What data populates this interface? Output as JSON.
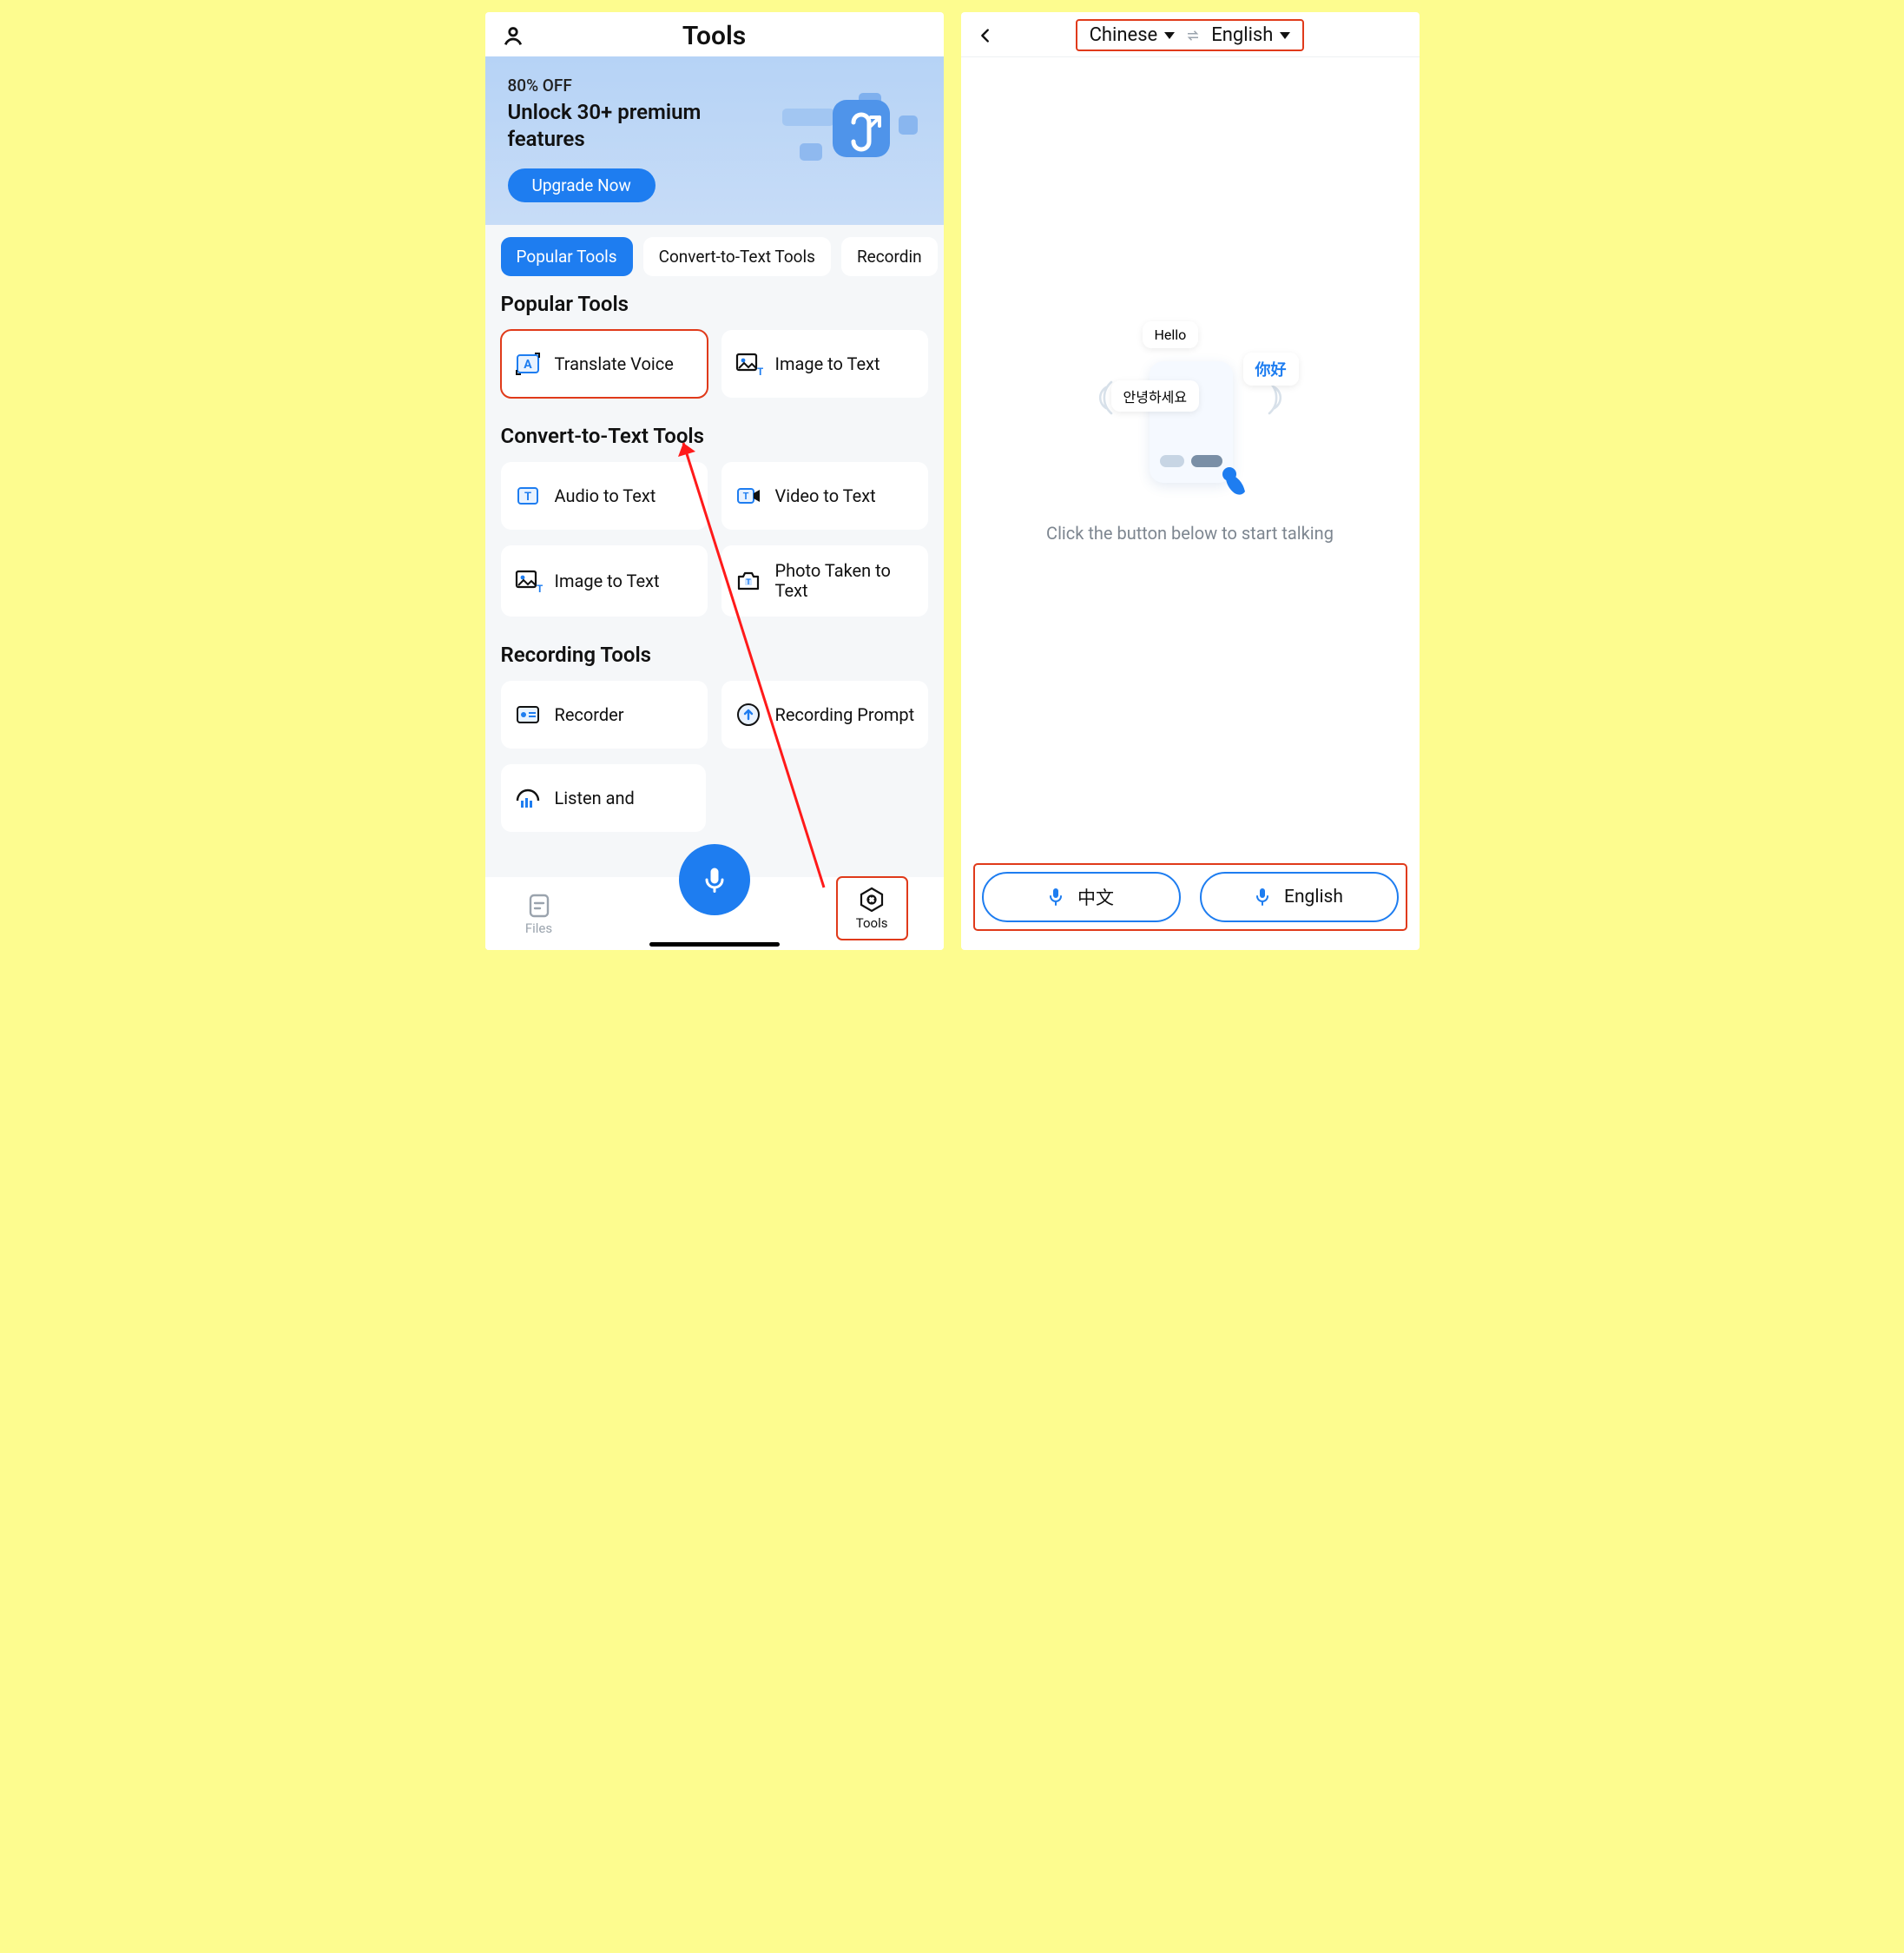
{
  "left": {
    "header_title": "Tools",
    "banner": {
      "off": "80% OFF",
      "title": "Unlock 30+ premium features",
      "cta": "Upgrade Now"
    },
    "tabs": [
      "Popular Tools",
      "Convert-to-Text Tools",
      "Recordin"
    ],
    "sections": {
      "popular": {
        "title": "Popular Tools",
        "items": [
          "Translate Voice",
          "Image to Text"
        ]
      },
      "convert": {
        "title": "Convert-to-Text Tools",
        "items": [
          "Audio to Text",
          "Video to Text",
          "Image to Text",
          "Photo Taken to Text"
        ]
      },
      "recording": {
        "title": "Recording Tools",
        "items": [
          "Recorder",
          "Recording Prompt",
          "Listen and"
        ]
      }
    },
    "nav": {
      "files": "Files",
      "tools": "Tools"
    }
  },
  "right": {
    "lang_from": "Chinese",
    "lang_to": "English",
    "illus": {
      "hello": "Hello",
      "nihao": "你好",
      "annyeong": "안녕하세요"
    },
    "hint": "Click the button below to start talking",
    "talk": {
      "zh": "中文",
      "en": "English"
    }
  }
}
